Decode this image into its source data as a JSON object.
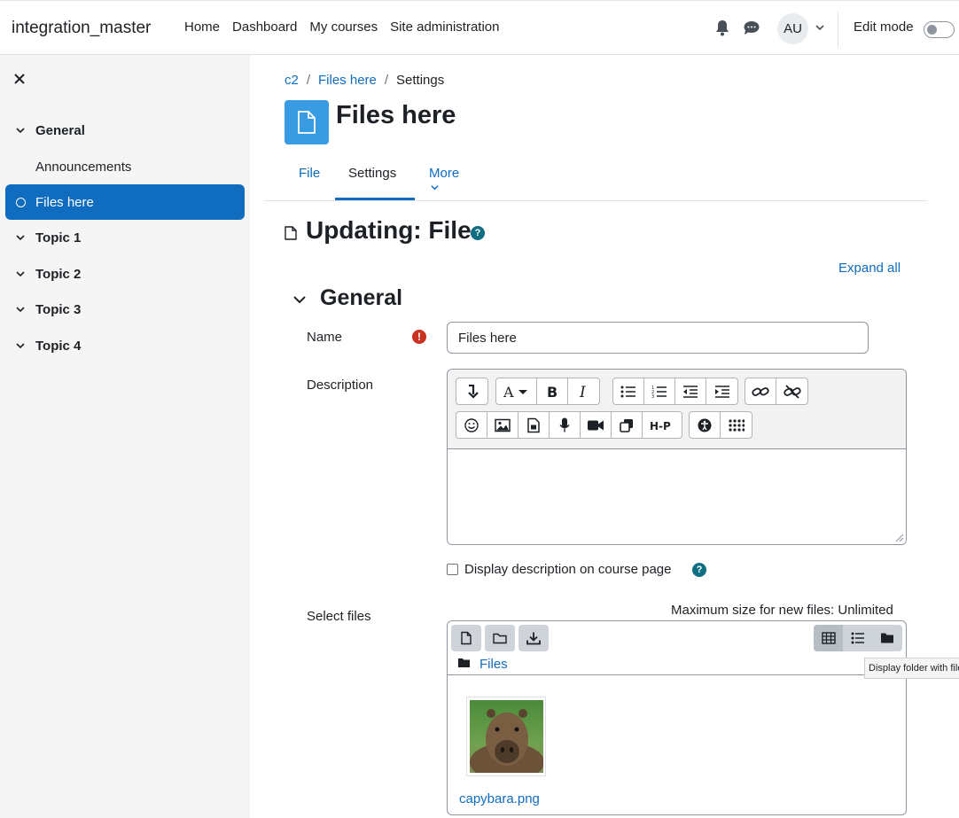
{
  "navbar": {
    "brand": "integration_master",
    "links": [
      "Home",
      "Dashboard",
      "My courses",
      "Site administration"
    ],
    "avatar_initials": "AU",
    "edit_mode_label": "Edit mode",
    "edit_mode_on": false
  },
  "sidebar": {
    "sections": [
      {
        "label": "General",
        "items": [
          "Announcements",
          "Files here"
        ]
      },
      {
        "label": "Topic 1"
      },
      {
        "label": "Topic 2"
      },
      {
        "label": "Topic 3"
      },
      {
        "label": "Topic 4"
      }
    ],
    "active_item": "Files here"
  },
  "breadcrumb": [
    "c2",
    "Files here",
    "Settings"
  ],
  "page": {
    "title": "Files here",
    "tabs": [
      "File",
      "Settings",
      "More"
    ],
    "active_tab": "Settings",
    "form_title": "Updating: File",
    "expand_all": "Expand all",
    "section_title": "General"
  },
  "form": {
    "name_label": "Name",
    "name_value": "Files here",
    "description_label": "Description",
    "display_description_label": "Display description on course page",
    "select_files_label": "Select files",
    "max_size_text": "Maximum size for new files: Unlimited",
    "path_folder": "Files",
    "file_name": "capybara.png",
    "tooltip": "Display folder with file"
  },
  "colors": {
    "primary": "#0f6cbf",
    "sidebar_bg": "#f5f5f5",
    "page_icon_bg": "#399be2",
    "required": "#ca3120",
    "help": "#0f6e82"
  }
}
